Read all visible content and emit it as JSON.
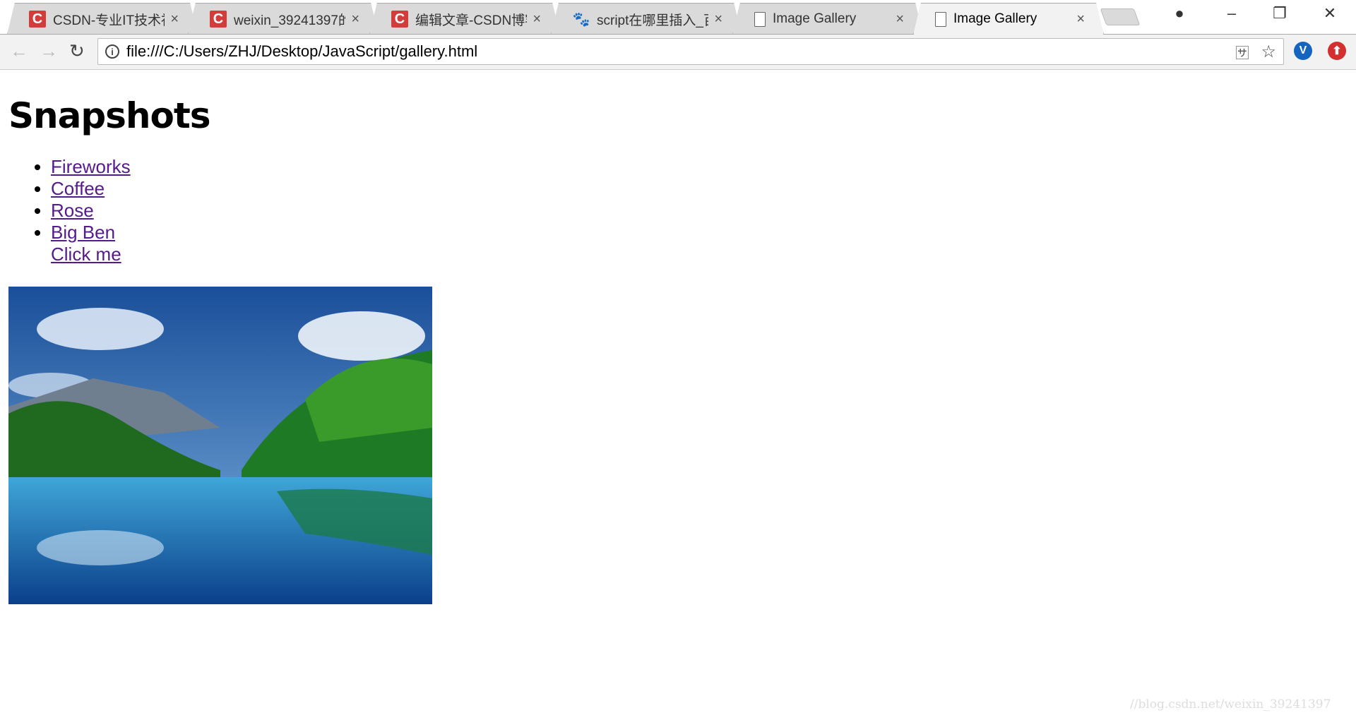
{
  "browser": {
    "tabs": [
      {
        "title": "CSDN-专业IT技术社",
        "icon": "csdn-icon",
        "active": false
      },
      {
        "title": "weixin_39241397的",
        "icon": "csdn-icon",
        "active": false
      },
      {
        "title": "编辑文章-CSDN博客",
        "icon": "csdn-icon",
        "active": false
      },
      {
        "title": "script在哪里插入_百",
        "icon": "baidu-icon",
        "active": false
      },
      {
        "title": "Image Gallery",
        "icon": "page-icon",
        "active": false
      },
      {
        "title": "Image Gallery",
        "icon": "page-icon",
        "active": true
      }
    ],
    "url": "file:///C:/Users/ZHJ/Desktop/JavaScript/gallery.html"
  },
  "page": {
    "heading": "Snapshots",
    "links": [
      "Fireworks",
      "Coffee",
      "Rose",
      "Big Ben"
    ],
    "extra_link": "Click me",
    "image": "landscape-river-photo"
  },
  "watermark": "//blog.csdn.net/weixin_39241397",
  "colors": {
    "link": "#551a8b",
    "csdn": "#d43c3c"
  }
}
